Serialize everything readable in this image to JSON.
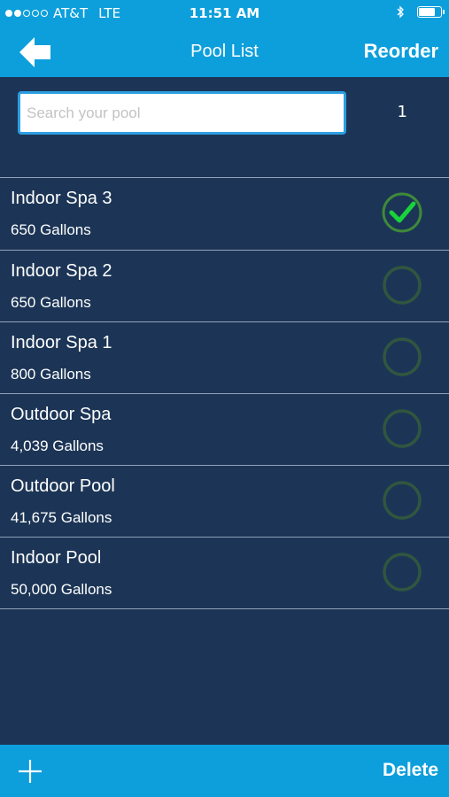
{
  "status_bar": {
    "signal_dots_filled": 2,
    "signal_dots_total": 5,
    "carrier": "AT&T",
    "network": "LTE",
    "time": "11:51 AM",
    "icons": [
      "bluetooth-icon",
      "battery-icon"
    ],
    "battery_level": 0.8
  },
  "nav": {
    "back_icon": "back-arrow-icon",
    "title": "Pool List",
    "reorder_label": "Reorder"
  },
  "search": {
    "placeholder": "Search your pool",
    "value": ""
  },
  "selected_count": "1",
  "pools": [
    {
      "name": "Indoor Spa 3",
      "volume": "650 Gallons",
      "selected": true
    },
    {
      "name": "Indoor Spa 2",
      "volume": "650 Gallons",
      "selected": false
    },
    {
      "name": "Indoor Spa 1",
      "volume": "800 Gallons",
      "selected": false
    },
    {
      "name": "Outdoor Spa",
      "volume": "4,039 Gallons",
      "selected": false
    },
    {
      "name": "Outdoor Pool",
      "volume": "41,675 Gallons",
      "selected": false
    },
    {
      "name": "Indoor Pool",
      "volume": "50,000 Gallons",
      "selected": false
    }
  ],
  "bottom_bar": {
    "add_icon": "plus-icon",
    "delete_label": "Delete"
  },
  "colors": {
    "accent": "#0d9fdc",
    "background": "#1c3556",
    "check_green": "#18d43a",
    "ring_unselected": "#31563f",
    "ring_selected": "#3f8a3a"
  }
}
